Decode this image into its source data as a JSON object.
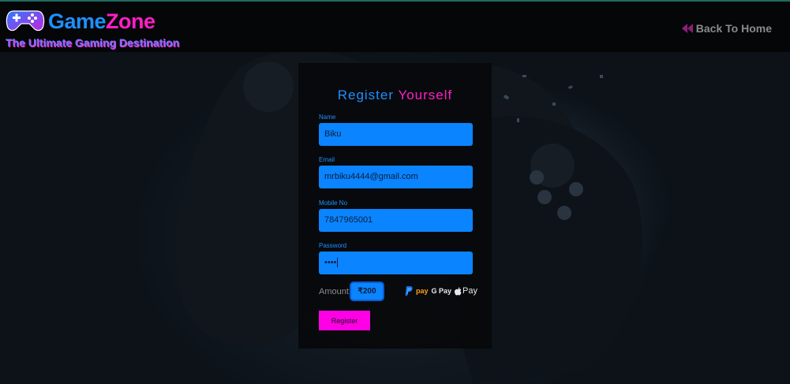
{
  "header": {
    "brand_part1": "Game",
    "brand_part2": "Zone",
    "tagline": "The Ultimate Gaming Destination",
    "back_link": "Back To Home",
    "logo_icon": "gamepad-icon",
    "back_icon": "double-chevron-left-icon"
  },
  "form": {
    "title_part1": "Register",
    "title_part2": "Yourself",
    "fields": [
      {
        "label": "Name",
        "value": "Biku"
      },
      {
        "label": "Email",
        "value": "mrbiku4444@gmail.com"
      },
      {
        "label": "Mobile No",
        "value": "7847965001"
      },
      {
        "label": "Password",
        "value": "••••"
      }
    ],
    "amount_label": "Amount:",
    "amount_value": "₹200",
    "payment_methods": [
      "paypal-icon",
      "pay",
      "G Pay",
      "Pay"
    ],
    "register_label": "Register"
  },
  "colors": {
    "brand_blue": "#1e90ff",
    "brand_pink": "#ff1fc7",
    "input_bg": "#0a84ff",
    "button_bg": "#ff00e6"
  }
}
